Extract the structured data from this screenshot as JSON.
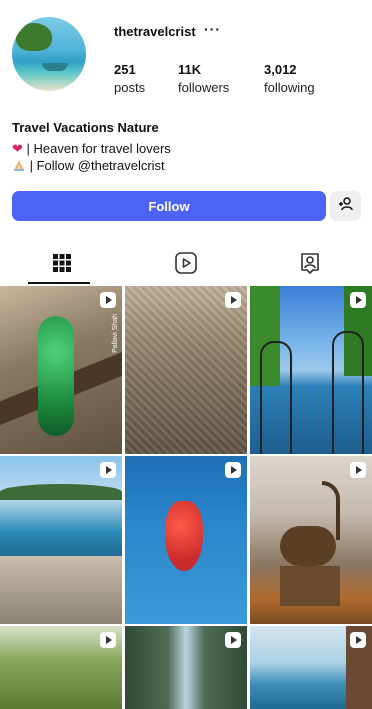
{
  "profile": {
    "username": "thetravelcrist",
    "more": "···",
    "stats": [
      {
        "value": "251",
        "label": "posts"
      },
      {
        "value": "11K",
        "label": "followers"
      },
      {
        "value": "3,012",
        "label": "following"
      }
    ],
    "bio_title": "Travel Vacations Nature",
    "bio_lines": [
      {
        "icon": "heart-emoji",
        "text": " | Heaven for travel lovers"
      },
      {
        "icon": "folded-hands-emoji",
        "text": " | Follow @thetravelcrist"
      }
    ]
  },
  "actions": {
    "follow_label": "Follow"
  },
  "tabs": [
    {
      "icon": "grid-icon",
      "selected": true
    },
    {
      "icon": "reels-icon",
      "selected": false
    },
    {
      "icon": "tagged-icon",
      "selected": false
    }
  ],
  "posts": [
    {
      "subject": "peacock on branch",
      "reel": true,
      "caption": "Pallavi Shah"
    },
    {
      "subject": "aerial city",
      "reel": true
    },
    {
      "subject": "gate by lake",
      "reel": true
    },
    {
      "subject": "coastal town",
      "reel": true
    },
    {
      "subject": "red sea creature",
      "reel": true
    },
    {
      "subject": "ibex on mountain",
      "reel": true
    },
    {
      "subject": "forest",
      "reel": true
    },
    {
      "subject": "canyon",
      "reel": true
    },
    {
      "subject": "ocean view",
      "reel": true
    }
  ],
  "colors": {
    "accent": "#4d63f5"
  }
}
